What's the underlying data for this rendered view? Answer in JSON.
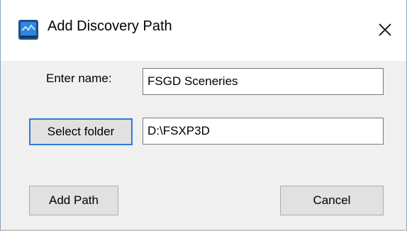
{
  "dialog": {
    "title": "Add Discovery Path",
    "app_icon": "monitor-app-icon",
    "close_icon": "close-icon",
    "accent_color": "#2f7ad6",
    "background_color": "#f0f0f0"
  },
  "form": {
    "name_label": "Enter name:",
    "name_value": "FSGD Sceneries",
    "folder_button_label": "Select folder",
    "folder_value": "D:\\FSXP3D"
  },
  "actions": {
    "add_label": "Add Path",
    "cancel_label": "Cancel"
  }
}
